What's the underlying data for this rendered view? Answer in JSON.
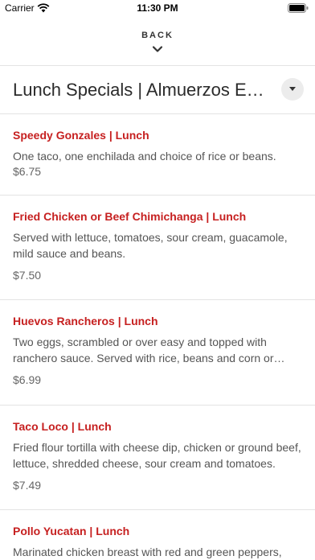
{
  "status_bar": {
    "carrier": "Carrier",
    "time": "11:30 PM"
  },
  "header": {
    "back_label": "BACK"
  },
  "category": {
    "title": "Lunch Specials | Almuerzos Especiales"
  },
  "colors": {
    "accent": "#c62020",
    "divider": "#e3e3e3"
  },
  "items": [
    {
      "name": "Speedy Gonzales | Lunch",
      "description": "One taco, one enchilada and choice of rice or beans.",
      "price": "$6.75"
    },
    {
      "name": "Fried Chicken or Beef Chimichanga | Lunch",
      "description": "Served with lettuce, tomatoes, sour cream, guacamole, mild sauce and beans.",
      "price": "$7.50"
    },
    {
      "name": "Huevos Rancheros | Lunch",
      "description": "Two eggs, scrambled or over easy and topped with ranchero sauce. Served with rice, beans and corn or flou…",
      "price": "$6.99"
    },
    {
      "name": "Taco Loco | Lunch",
      "description": "Fried flour tortilla with cheese dip, chicken or ground beef, lettuce, shredded cheese, sour cream and tomatoes.",
      "price": "$7.49"
    },
    {
      "name": "Pollo Yucatan | Lunch",
      "description": "Marinated chicken breast with red and green peppers,",
      "price": ""
    }
  ]
}
